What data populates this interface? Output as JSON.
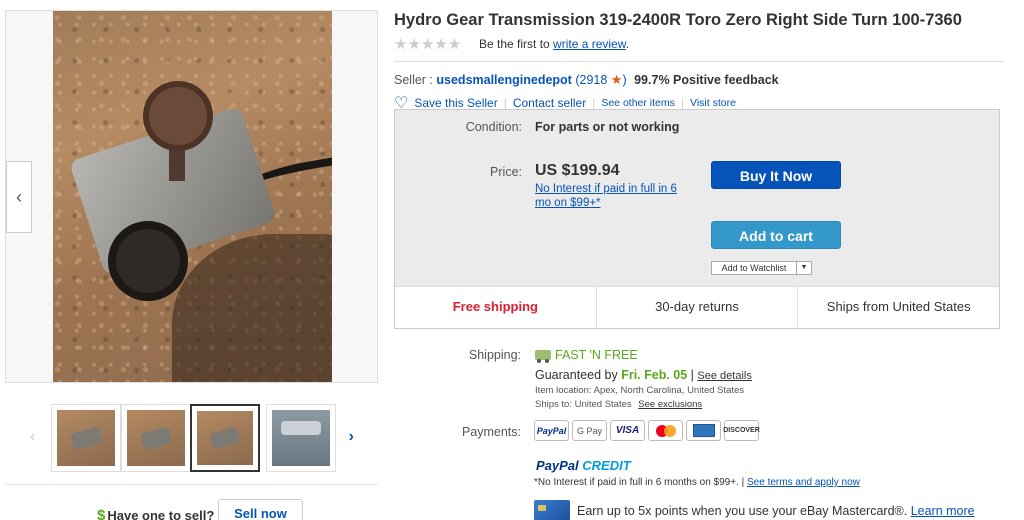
{
  "title": "Hydro Gear Transmission 319-2400R Toro Zero Right Side Turn 100-7360",
  "rating": {
    "stars": "★★★★★",
    "first_text": "Be the first to",
    "write_review": "write a review",
    "period": "."
  },
  "seller": {
    "label": "Seller :",
    "name": "usedsmallenginedepot",
    "feedback_open": "(",
    "feedback_count": "2918",
    "feedback_close": ")",
    "positive": "99.7% Positive feedback",
    "save": "Save this Seller",
    "sep": "|",
    "contact": "Contact seller",
    "other_items": "See other items",
    "visit_store": "Visit store"
  },
  "item": {
    "condition_label": "Condition:",
    "condition_value": "For parts or not working",
    "price_label": "Price:",
    "price_value": "US $199.94",
    "no_interest": "No Interest if paid in full in 6 mo on $99+*",
    "buy_now": "Buy It Now",
    "add_to_cart": "Add to cart",
    "add_watchlist": "Add to Watchlist",
    "features": [
      "Free shipping",
      "30-day returns",
      "Ships from United States"
    ]
  },
  "shipping": {
    "label": "Shipping:",
    "fast": "FAST 'N FREE",
    "guaranteed": "Guaranteed by",
    "date": "Fri. Feb. 05",
    "sep": "|",
    "see_details": "See details",
    "location": "Item location:  Apex, North Carolina, United States",
    "ships_to": "Ships to:  United States",
    "see_exclusions": "See exclusions"
  },
  "payments": {
    "label": "Payments:",
    "methods": [
      "PayPal",
      "G Pay",
      "VISA",
      "mastercard",
      "amex",
      "DISCOVER"
    ]
  },
  "paypal_credit": {
    "paypal": "PayPal",
    "credit": "CREDIT",
    "note": "*No Interest if paid in full in 6 months on $99+.  |",
    "terms": "See terms and apply now"
  },
  "earn": {
    "text": "Earn up to 5x points when you use your eBay Mastercard®.",
    "learn_more": "Learn more"
  },
  "sell": {
    "dollar": "$",
    "question": "Have one to sell?",
    "button": "Sell now"
  },
  "gallery": {
    "prev": "‹",
    "next": "›",
    "thumb_prev": "‹",
    "thumb_next": "›"
  },
  "colors": {
    "link": "#0654ba",
    "buy_button": "#0654ba",
    "cart_button": "#3498ca",
    "free_shipping": "#dd1e31",
    "fast_green": "#5ba71b",
    "feedback_star": "#e05b20"
  }
}
